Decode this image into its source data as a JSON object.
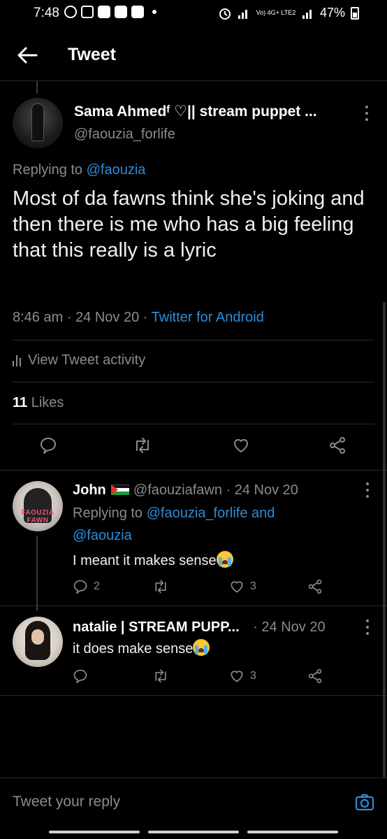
{
  "status_bar": {
    "time": "7:48",
    "carrier": "Vo) 4G+ LTE2",
    "battery": "47%"
  },
  "header": {
    "title": "Tweet"
  },
  "tweet": {
    "author_name": "Sama Ahmedᶠ ♡|| stream puppet ...",
    "author_handle": "@faouzia_forlife",
    "replying_prefix": "Replying to",
    "replying_to": "@faouzia",
    "text": "Most of da fawns think she's joking and then there is me who has a big feeling that this really is a lyric",
    "time": "8:46 am",
    "date": "24 Nov 20",
    "sep": "·",
    "source": "Twitter for Android",
    "activity_label": "View Tweet activity",
    "likes_count": "11",
    "likes_label": "Likes"
  },
  "replies": [
    {
      "name": "John",
      "handle": "@faouziafawn",
      "date": "24 Nov 20",
      "avatar_text": "FAOUZIA FAWN",
      "replying_prefix": "Replying to",
      "replying_to_1": "@faouzia_forlife",
      "replying_and": "and",
      "replying_to_2": "@faouzia",
      "text": "I meant it makes sense",
      "reply_count": "2",
      "like_count": "3"
    },
    {
      "name": "natalie | STREAM PUPP...",
      "date": "24 Nov 20",
      "text": "it does make sense",
      "like_count": "3"
    }
  ],
  "compose": {
    "placeholder": "Tweet your reply"
  },
  "colors": {
    "background": "#000000",
    "link": "#2f8bd7",
    "muted": "#8b8b8b"
  }
}
